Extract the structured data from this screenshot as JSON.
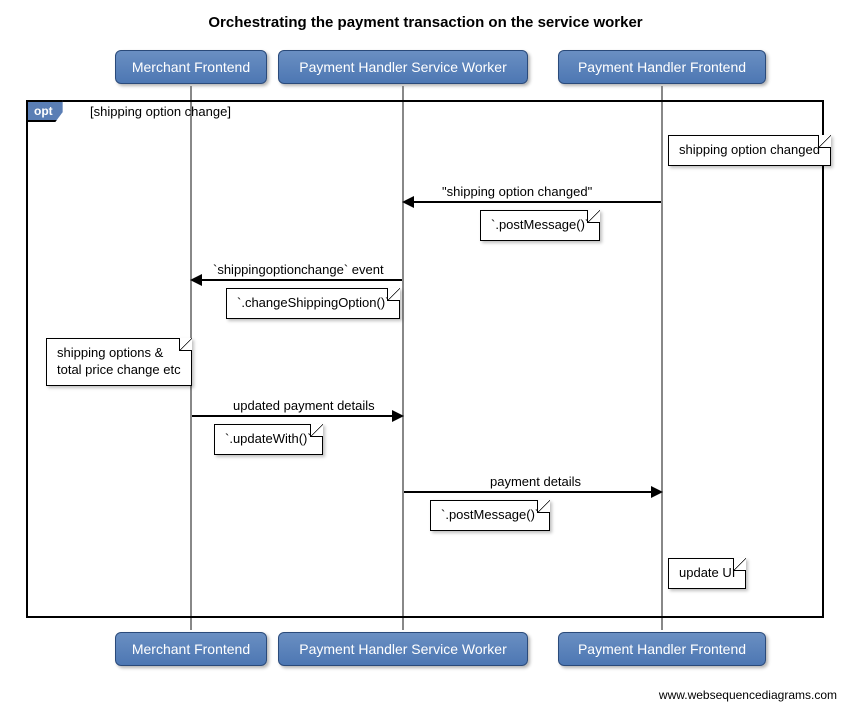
{
  "title": "Orchestrating the payment transaction on the service worker",
  "participants": {
    "p1": "Merchant Frontend",
    "p2": "Payment Handler Service Worker",
    "p3": "Payment Handler Frontend"
  },
  "opt": {
    "tag": "opt",
    "guard": "[shipping option change]"
  },
  "notes": {
    "n1": "shipping option changed",
    "n2": "`.postMessage()`",
    "n3": "`.changeShippingOption()`",
    "n4_line1": "shipping options &",
    "n4_line2": "total price change etc",
    "n5": "`.updateWith()`",
    "n6": "`.postMessage()`",
    "n7": "update UI"
  },
  "messages": {
    "m1": "\"shipping option changed\"",
    "m2": "`shippingoptionchange` event",
    "m3": "updated payment details",
    "m4": "payment details"
  },
  "watermark": "www.websequencediagrams.com",
  "chart_data": {
    "type": "sequence-diagram",
    "title": "Orchestrating the payment transaction on the service worker",
    "participants": [
      "Merchant Frontend",
      "Payment Handler Service Worker",
      "Payment Handler Frontend"
    ],
    "fragments": [
      {
        "type": "opt",
        "guard": "shipping option change",
        "steps": [
          {
            "type": "note",
            "participant": "Payment Handler Frontend",
            "text": "shipping option changed"
          },
          {
            "type": "message",
            "from": "Payment Handler Frontend",
            "to": "Payment Handler Service Worker",
            "label": "\"shipping option changed\"",
            "annotation": ".postMessage()"
          },
          {
            "type": "message",
            "from": "Payment Handler Service Worker",
            "to": "Merchant Frontend",
            "label": "shippingoptionchange event",
            "annotation": ".changeShippingOption()"
          },
          {
            "type": "note",
            "participant": "Merchant Frontend",
            "text": "shipping options & total price change etc"
          },
          {
            "type": "message",
            "from": "Merchant Frontend",
            "to": "Payment Handler Service Worker",
            "label": "updated payment details",
            "annotation": ".updateWith()"
          },
          {
            "type": "message",
            "from": "Payment Handler Service Worker",
            "to": "Payment Handler Frontend",
            "label": "payment details",
            "annotation": ".postMessage()"
          },
          {
            "type": "note",
            "participant": "Payment Handler Frontend",
            "text": "update UI"
          }
        ]
      }
    ]
  }
}
